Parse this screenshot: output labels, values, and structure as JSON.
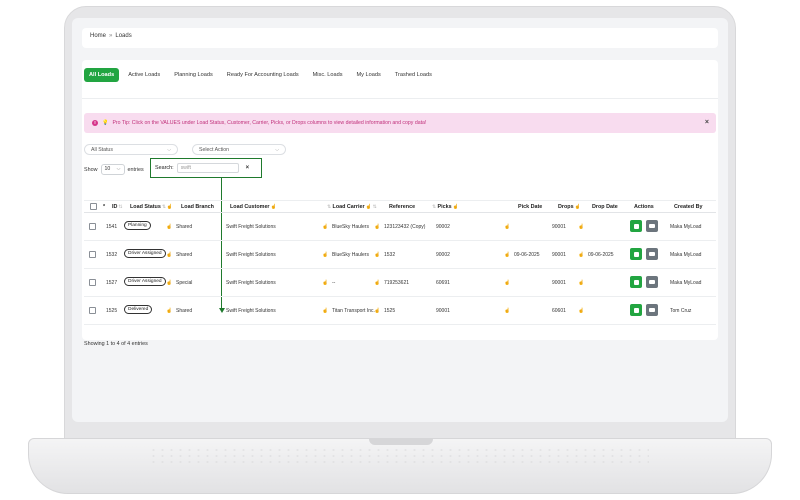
{
  "breadcrumb": {
    "home": "Home",
    "current": "Loads"
  },
  "tabs": [
    "All Loads",
    "Active Loads",
    "Planning Loads",
    "Ready For Accounting Loads",
    "Misc. Loads",
    "My Loads",
    "Trashed Loads"
  ],
  "tip": {
    "text": "Pro Tip: Click on the VALUES under Load Status, Customer, Carrier, Picks, or Drops columns to view detailed information and copy data!",
    "close": "×"
  },
  "filters": {
    "status": "All Status",
    "action": "Select Action"
  },
  "entries": {
    "show": "Show",
    "value": "10",
    "suffix": "entries"
  },
  "search": {
    "label": "Search:",
    "value": "swift",
    "clear": "×"
  },
  "table": {
    "headers": [
      "*",
      "ID",
      "Load Status",
      "Load Branch",
      "Load Customer",
      "Load Carrier",
      "Reference",
      "Picks",
      "Pick Date",
      "Drops",
      "Drop Date",
      "Actions",
      "Created By"
    ],
    "rows": [
      {
        "id": "1541",
        "status": "Planning",
        "branch": "Shared",
        "customer": "Swift Freight Solutions",
        "carrier": "BlueSky Haulers",
        "reference": "123123432 (Copy)",
        "picks": "90002",
        "pick_date": "",
        "drops": "90001",
        "drop_date": "",
        "created_by": "Maka MyLoad"
      },
      {
        "id": "1532",
        "status": "Driver Assigned",
        "branch": "Shared",
        "customer": "Swift Freight Solutions",
        "carrier": "BlueSky Haulers",
        "reference": "1532",
        "picks": "90002",
        "pick_date": "09-06-2025",
        "drops": "90001",
        "drop_date": "09-06-2025",
        "created_by": "Maka MyLoad"
      },
      {
        "id": "1527",
        "status": "Driver Assigned",
        "branch": "Special",
        "customer": "Swift Freight Solutions",
        "carrier": "--",
        "reference": "719253621",
        "picks": "60691",
        "pick_date": "",
        "drops": "90001",
        "drop_date": "",
        "created_by": "Maka MyLoad"
      },
      {
        "id": "1525",
        "status": "Delivered",
        "branch": "Shared",
        "customer": "Swift Freight Solutions",
        "carrier": "Titan Transport Inc.",
        "reference": "1525",
        "picks": "90001",
        "pick_date": "",
        "drops": "60601",
        "drop_date": "",
        "created_by": "Tom Cruz"
      }
    ]
  },
  "footer": {
    "showing": "Showing 1 to 4 of 4 entries"
  },
  "colors": {
    "accent": "#22a541",
    "tip_bg": "#f8dcef",
    "tip_text": "#c0307a",
    "highlight": "#1f7a2d"
  },
  "icons": {
    "sort": "sort-arrows-icon",
    "action_edit": "copy-icon",
    "action_truck": "truck-icon",
    "tip": "lightbulb-icon"
  }
}
